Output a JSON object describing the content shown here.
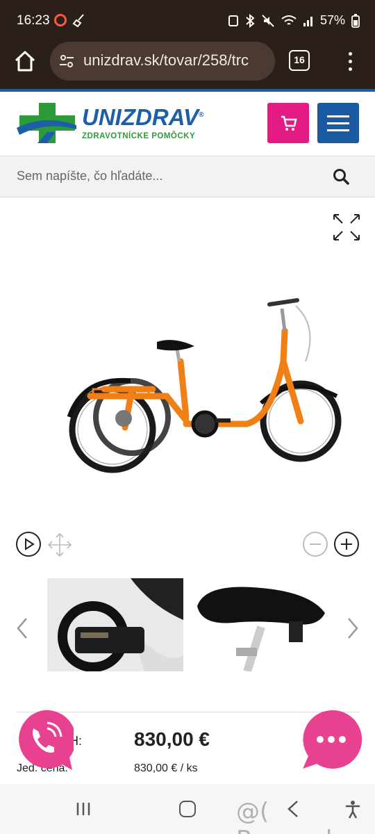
{
  "status_bar": {
    "time": "16:23",
    "battery": "57%"
  },
  "browser": {
    "url": "unizdrav.sk/tovar/258/trc",
    "tab_count": "16"
  },
  "site": {
    "brand": "UNIZDRAV",
    "brand_mark": "®",
    "tagline": "ZDRAVOTNÍCKE POMÔCKY",
    "colors": {
      "blue": "#1d5ea8",
      "green": "#2e9b3a",
      "pink": "#e31b83"
    }
  },
  "search": {
    "placeholder": "Sem napíšte, čo hľadáte..."
  },
  "product": {
    "price_label": "H:",
    "price": "830,00 €",
    "unit_label": "Jed. cena:",
    "unit_price": "830,00 € / ks"
  },
  "watermark": "@( Bazos.sk"
}
